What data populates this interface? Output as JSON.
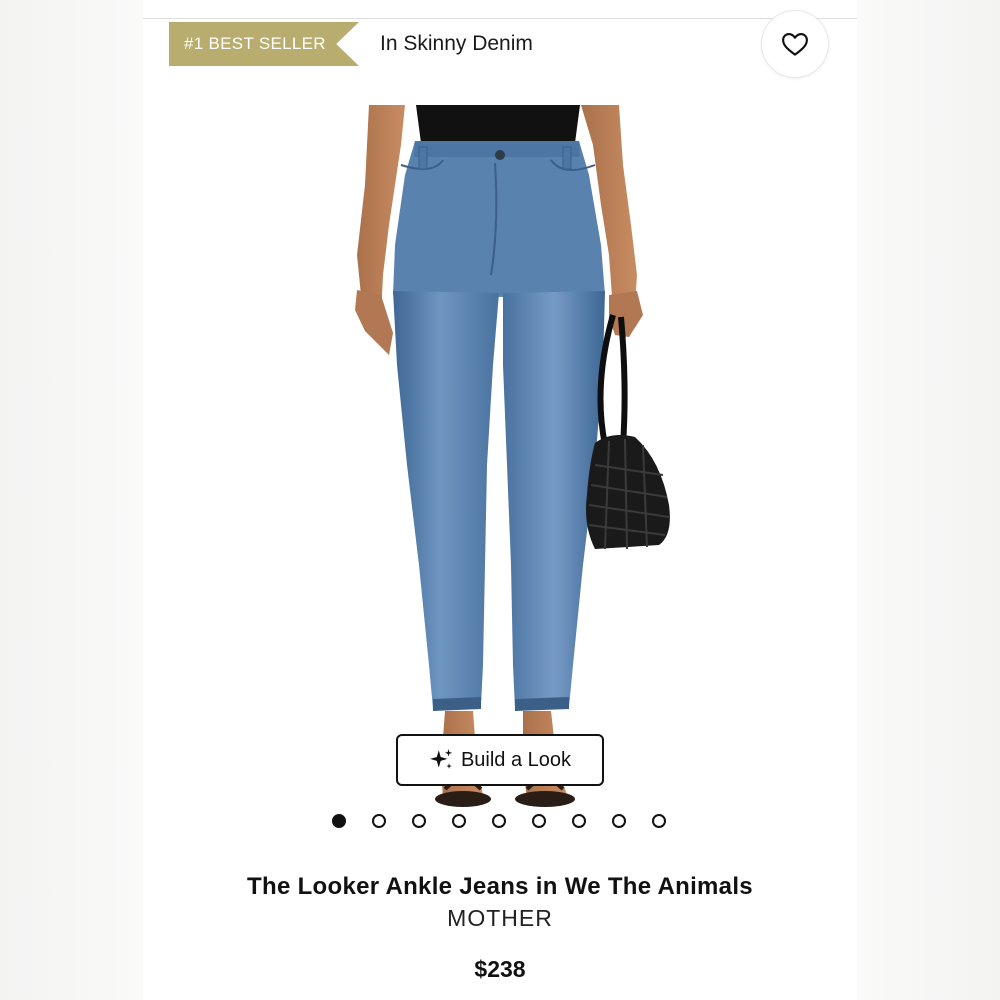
{
  "header": {
    "badge": "#1 BEST SELLER",
    "category": "In Skinny Denim",
    "favorite_icon": "heart-outline-icon"
  },
  "gallery": {
    "build_look_label": "Build a Look",
    "build_look_icon": "sparkle-icon",
    "total_images": 9,
    "active_index": 0
  },
  "product": {
    "name": "The Looker Ankle Jeans in We The Animals",
    "brand": "MOTHER",
    "price": "$238"
  },
  "colors": {
    "badge_bg": "#b8ad6e",
    "denim": "#5f86b3"
  }
}
